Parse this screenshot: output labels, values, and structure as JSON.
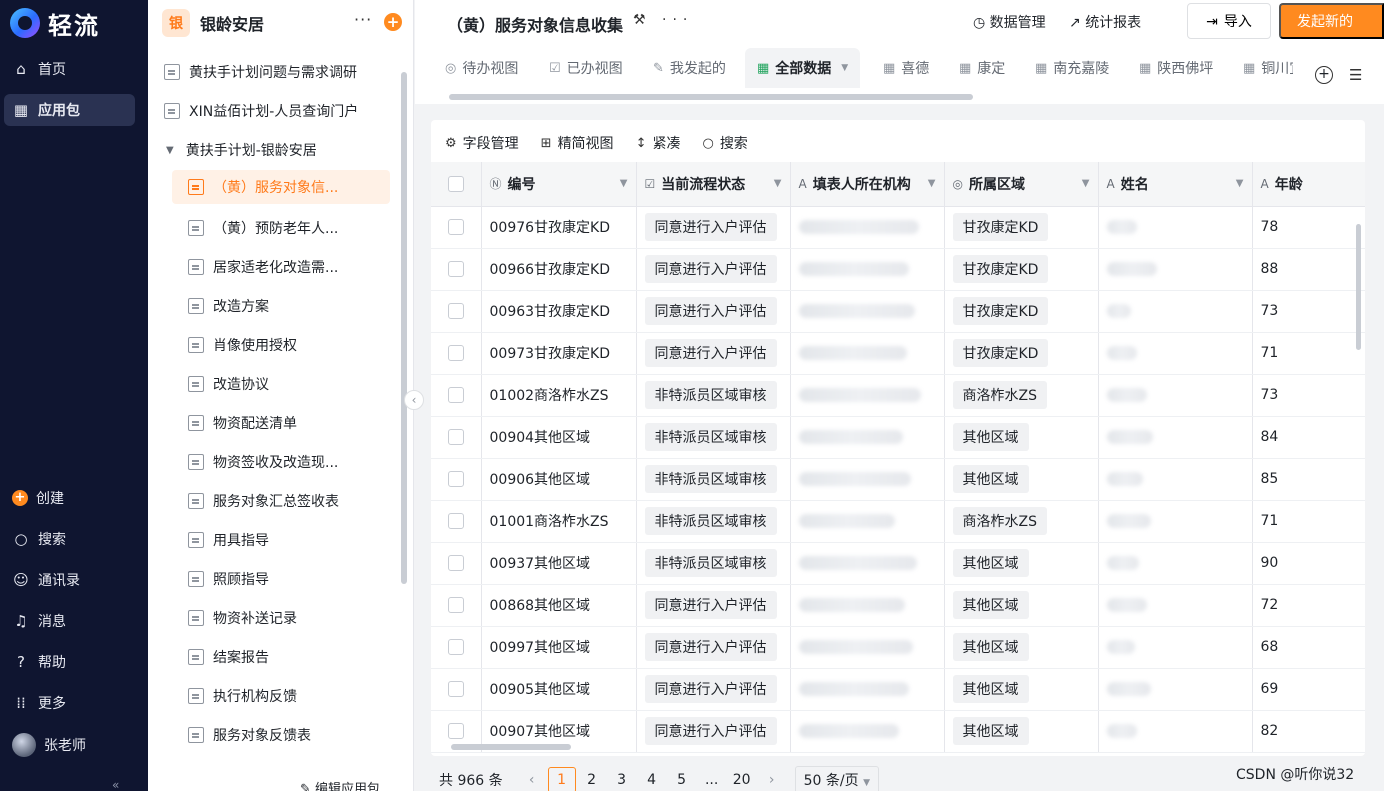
{
  "nav": {
    "logo_text": "轻流",
    "items": [
      {
        "label": "首页"
      },
      {
        "label": "应用包"
      }
    ],
    "bottom_items": [
      {
        "label": "创建"
      },
      {
        "label": "搜索"
      },
      {
        "label": "通讯录"
      },
      {
        "label": "消息"
      },
      {
        "label": "帮助"
      },
      {
        "label": "更多"
      }
    ],
    "user_name": "张老师"
  },
  "sidebar": {
    "app_badge": "银",
    "app_name": "银龄安居",
    "items": [
      {
        "label": "黄扶手计划问题与需求调研"
      },
      {
        "label": "XIN益佰计划-人员查询门户"
      },
      {
        "label": "黄扶手计划-银龄安居"
      },
      {
        "label": "（黄）服务对象信..."
      },
      {
        "label": "（黄）预防老年人..."
      },
      {
        "label": "居家适老化改造需..."
      },
      {
        "label": "改造方案"
      },
      {
        "label": "肖像使用授权"
      },
      {
        "label": "改造协议"
      },
      {
        "label": "物资配送清单"
      },
      {
        "label": "物资签收及改造现..."
      },
      {
        "label": "服务对象汇总签收表"
      },
      {
        "label": "用具指导"
      },
      {
        "label": "照顾指导"
      },
      {
        "label": "物资补送记录"
      },
      {
        "label": "结案报告"
      },
      {
        "label": "执行机构反馈"
      },
      {
        "label": "服务对象反馈表"
      }
    ],
    "footer": "编辑应用包"
  },
  "header": {
    "title": "（黄）服务对象信息收集",
    "data_manage": "数据管理",
    "stats": "统计报表",
    "import": "导入",
    "new": "发起新的"
  },
  "tabs": [
    {
      "label": "待办视图"
    },
    {
      "label": "已办视图"
    },
    {
      "label": "我发起的"
    },
    {
      "label": "全部数据"
    },
    {
      "label": "喜德"
    },
    {
      "label": "康定"
    },
    {
      "label": "南充嘉陵"
    },
    {
      "label": "陕西佛坪"
    },
    {
      "label": "铜川宜"
    }
  ],
  "toolbar": {
    "fields": "字段管理",
    "compact_view": "精简视图",
    "density": "紧凑",
    "search": "搜索"
  },
  "table": {
    "columns": [
      "编号",
      "当前流程状态",
      "填表人所在机构",
      "所属区域",
      "姓名",
      "年龄"
    ],
    "rows": [
      {
        "id": "00976甘孜康定KD",
        "status": "同意进行入户评估",
        "region": "甘孜康定KD",
        "age": "78"
      },
      {
        "id": "00966甘孜康定KD",
        "status": "同意进行入户评估",
        "region": "甘孜康定KD",
        "age": "88"
      },
      {
        "id": "00963甘孜康定KD",
        "status": "同意进行入户评估",
        "region": "甘孜康定KD",
        "age": "73"
      },
      {
        "id": "00973甘孜康定KD",
        "status": "同意进行入户评估",
        "region": "甘孜康定KD",
        "age": "71"
      },
      {
        "id": "01002商洛柞水ZS",
        "status": "非特派员区域审核",
        "region": "商洛柞水ZS",
        "age": "73"
      },
      {
        "id": "00904其他区域",
        "status": "非特派员区域审核",
        "region": "其他区域",
        "age": "84"
      },
      {
        "id": "00906其他区域",
        "status": "非特派员区域审核",
        "region": "其他区域",
        "age": "85"
      },
      {
        "id": "01001商洛柞水ZS",
        "status": "非特派员区域审核",
        "region": "商洛柞水ZS",
        "age": "71"
      },
      {
        "id": "00937其他区域",
        "status": "非特派员区域审核",
        "region": "其他区域",
        "age": "90"
      },
      {
        "id": "00868其他区域",
        "status": "同意进行入户评估",
        "region": "其他区域",
        "age": "72"
      },
      {
        "id": "00997其他区域",
        "status": "同意进行入户评估",
        "region": "其他区域",
        "age": "68"
      },
      {
        "id": "00905其他区域",
        "status": "同意进行入户评估",
        "region": "其他区域",
        "age": "69"
      },
      {
        "id": "00907其他区域",
        "status": "同意进行入户评估",
        "region": "其他区域",
        "age": "82"
      }
    ]
  },
  "pagination": {
    "total": "共 966 条",
    "pages": [
      "1",
      "2",
      "3",
      "4",
      "5",
      "...",
      "20"
    ],
    "page_size": "50 条/页"
  },
  "watermark": "CSDN @听你说32",
  "colors": {
    "accent": "#ff8a1f",
    "nav_bg": "#0f1530"
  }
}
